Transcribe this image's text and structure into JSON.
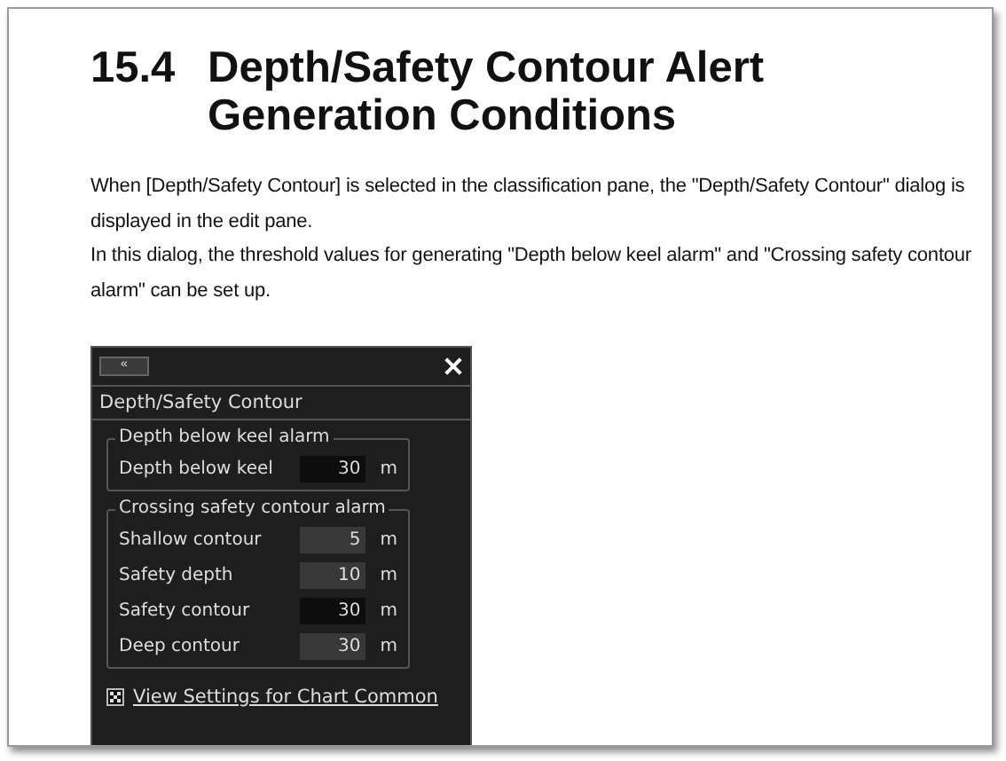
{
  "heading": {
    "number": "15.4",
    "title": "Depth/Safety Contour Alert Generation Conditions"
  },
  "paragraphs": [
    "When [Depth/Safety Contour] is selected in the classification pane, the \"Depth/Safety Contour\" dialog is displayed in the edit pane.",
    "In this dialog, the threshold values for generating \"Depth below keel alarm\" and \"Crossing safety contour alarm\" can be set up."
  ],
  "dialog": {
    "collapse_button": "«",
    "title": "Depth/Safety Contour",
    "groups": [
      {
        "legend": "Depth below keel alarm",
        "fields": [
          {
            "label": "Depth below keel",
            "value": "30",
            "unit": "m",
            "editable": true
          }
        ]
      },
      {
        "legend": "Crossing safety contour alarm",
        "fields": [
          {
            "label": "Shallow contour",
            "value": "5",
            "unit": "m",
            "editable": false
          },
          {
            "label": "Safety depth",
            "value": "10",
            "unit": "m",
            "editable": false
          },
          {
            "label": "Safety contour",
            "value": "30",
            "unit": "m",
            "editable": true
          },
          {
            "label": "Deep contour",
            "value": "30",
            "unit": "m",
            "editable": false
          }
        ]
      }
    ],
    "link": "View Settings for Chart Common"
  }
}
